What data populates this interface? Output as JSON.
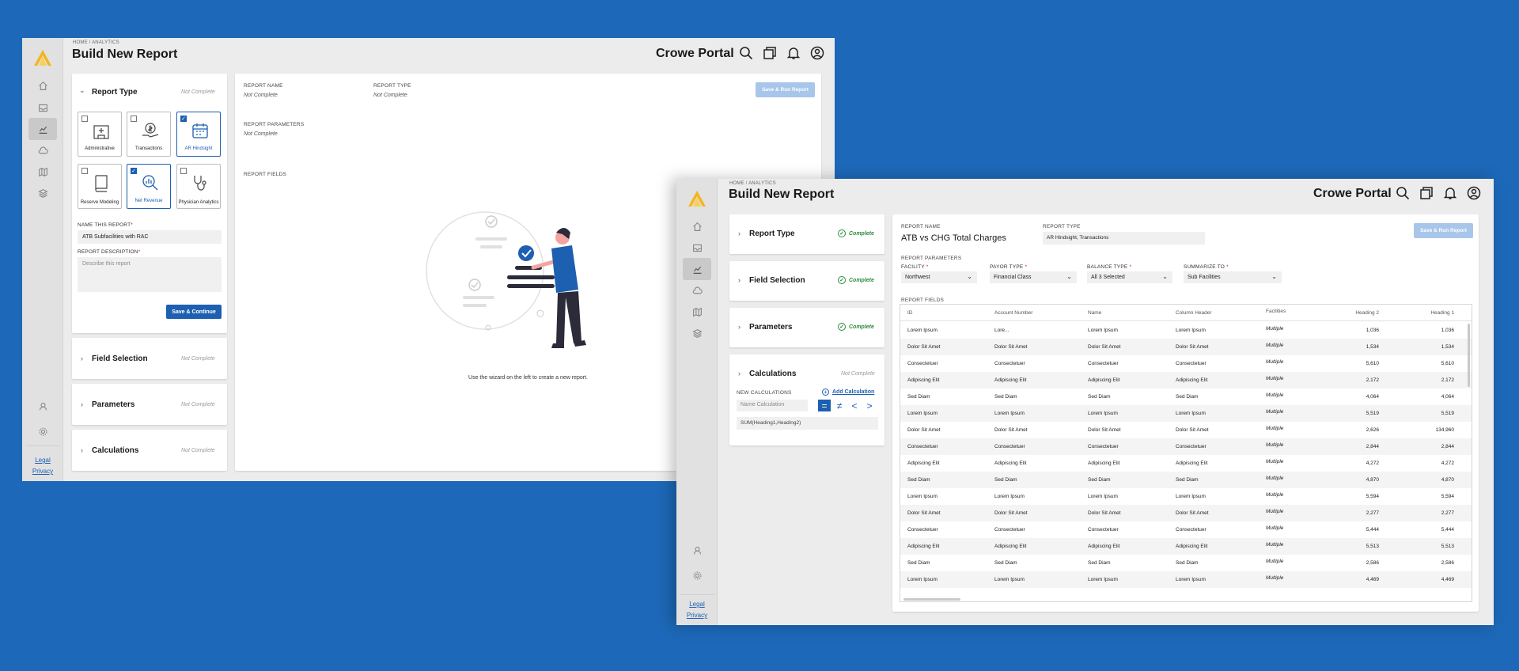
{
  "breadcrumb": "HOME / ANALYTICS",
  "page_title": "Build New Report",
  "brand": "Crowe Portal",
  "footer": {
    "legal": "Legal",
    "privacy": "Privacy"
  },
  "colors": {
    "background": "#1d68b8",
    "primary": "#1d5fb0",
    "complete": "#2c8c3c",
    "logo": "#f2b61d"
  },
  "icons": [
    "search-icon",
    "cards-icon",
    "bell-icon",
    "user-circle-icon",
    "home-icon",
    "inbox-icon",
    "chart-icon",
    "cloud-icon",
    "map-icon",
    "layers-icon",
    "user-icon",
    "gear-icon"
  ],
  "win1": {
    "wizard": {
      "report_type": {
        "title": "Report Type",
        "status": "Not Complete"
      },
      "tiles": [
        {
          "label": "Administrative",
          "checked": false
        },
        {
          "label": "Transactions",
          "checked": false
        },
        {
          "label": "AR Hindsight",
          "checked": true
        },
        {
          "label": "Reserve Modeling",
          "checked": false
        },
        {
          "label": "Net Revenue",
          "checked": true
        },
        {
          "label": "Physician Analytics",
          "checked": false
        }
      ],
      "name_label": "NAME THIS REPORT",
      "name_value": "ATB Subfacilities with RAC",
      "desc_label": "REPORT DESCRIPTION",
      "desc_placeholder": "Describe this report",
      "save_continue": "Save & Continue",
      "sections": [
        {
          "title": "Field Selection",
          "status": "Not Complete"
        },
        {
          "title": "Parameters",
          "status": "Not Complete"
        },
        {
          "title": "Calculations",
          "status": "Not Complete"
        }
      ]
    },
    "summary": {
      "report_name_label": "REPORT NAME",
      "report_name_value": "Not Complete",
      "report_type_label": "REPORT TYPE",
      "report_type_value": "Not Complete",
      "params_label": "REPORT PARAMETERS",
      "params_value": "Not Complete",
      "fields_label": "REPORT FIELDS",
      "save_run": "Save & Run Report",
      "empty_hint": "Use the wizard on the left to create a new report."
    }
  },
  "win2": {
    "sections": [
      {
        "title": "Report Type",
        "status": "Complete"
      },
      {
        "title": "Field Selection",
        "status": "Complete"
      },
      {
        "title": "Parameters",
        "status": "Complete"
      }
    ],
    "calculations": {
      "title": "Calculations",
      "status": "Not Complete",
      "new_label": "NEW CALCULATIONS",
      "add_label": "Add Calculation",
      "name_placeholder": "Name Calculation",
      "formula": "SUM(Heading1,Heading2)",
      "ops": [
        "=",
        "≠",
        "<",
        ">"
      ]
    },
    "summary": {
      "report_name_label": "REPORT NAME",
      "report_name_value": "ATB vs CHG Total Charges",
      "report_type_label": "REPORT TYPE",
      "report_type_value": "AR Hindsight, Transactions",
      "save_run": "Save & Run Report",
      "params_label": "REPORT PARAMETERS",
      "params": [
        {
          "label": "FACILITY",
          "value": "Northwest"
        },
        {
          "label": "PAYOR TYPE",
          "value": "Financial Class"
        },
        {
          "label": "BALANCE TYPE",
          "value": "All 3 Selected"
        },
        {
          "label": "SUMMARIZE TO",
          "value": "Sub Facilities"
        }
      ],
      "fields_label": "REPORT FIELDS"
    },
    "table": {
      "columns": [
        "ID",
        "Account Number",
        "Name",
        "Column Header",
        "Facilities",
        "Heading 2",
        "Heading 1"
      ],
      "rows": [
        [
          "Lorem Ipsum",
          "Lore...",
          "Lorem Ipsum",
          "Lorem Ipsum",
          "Multiple",
          "1,036",
          "1,036"
        ],
        [
          "Dolor Sit Amet",
          "Dolor Sit Amet",
          "Dolor Sit Amet",
          "Dolor Sit Amet",
          "Multiple",
          "1,534",
          "1,534"
        ],
        [
          "Consectetuer",
          "Consectetuer",
          "Consectetuer",
          "Consectetuer",
          "Multiple",
          "5,610",
          "5,610"
        ],
        [
          "Adipiscing Elit",
          "Adipiscing Elit",
          "Adipiscing Elit",
          "Adipiscing Elit",
          "Multiple",
          "2,172",
          "2,172"
        ],
        [
          "Sed Diam",
          "Sed Diam",
          "Sed Diam",
          "Sed Diam",
          "Multiple",
          "4,064",
          "4,064"
        ],
        [
          "Lorem Ipsum",
          "Lorem Ipsum",
          "Lorem Ipsum",
          "Lorem Ipsum",
          "Multiple",
          "5,519",
          "5,519"
        ],
        [
          "Dolor Sit Amet",
          "Dolor Sit Amet",
          "Dolor Sit Amet",
          "Dolor Sit Amet",
          "Multiple",
          "2,626",
          "134,960"
        ],
        [
          "Consectetuer",
          "Consectetuer",
          "Consectetuer",
          "Consectetuer",
          "Multiple",
          "2,844",
          "2,844"
        ],
        [
          "Adipiscing Elit",
          "Adipiscing Elit",
          "Adipiscing Elit",
          "Adipiscing Elit",
          "Multiple",
          "4,272",
          "4,272"
        ],
        [
          "Sed Diam",
          "Sed Diam",
          "Sed Diam",
          "Sed Diam",
          "Multiple",
          "4,870",
          "4,870"
        ],
        [
          "Lorem Ipsum",
          "Lorem Ipsum",
          "Lorem Ipsum",
          "Lorem Ipsum",
          "Multiple",
          "5,594",
          "5,594"
        ],
        [
          "Dolor Sit Amet",
          "Dolor Sit Amet",
          "Dolor Sit Amet",
          "Dolor Sit Amet",
          "Multiple",
          "2,277",
          "2,277"
        ],
        [
          "Consectetuer",
          "Consectetuer",
          "Consectetuer",
          "Consectetuer",
          "Multiple",
          "5,444",
          "5,444"
        ],
        [
          "Adipiscing Elit",
          "Adipiscing Elit",
          "Adipiscing Elit",
          "Adipiscing Elit",
          "Multiple",
          "5,513",
          "5,513"
        ],
        [
          "Sed Diam",
          "Sed Diam",
          "Sed Diam",
          "Sed Diam",
          "Multiple",
          "2,586",
          "2,586"
        ],
        [
          "Lorem Ipsum",
          "Lorem Ipsum",
          "Lorem Ipsum",
          "Lorem Ipsum",
          "Multiple",
          "4,469",
          "4,469"
        ]
      ]
    }
  }
}
